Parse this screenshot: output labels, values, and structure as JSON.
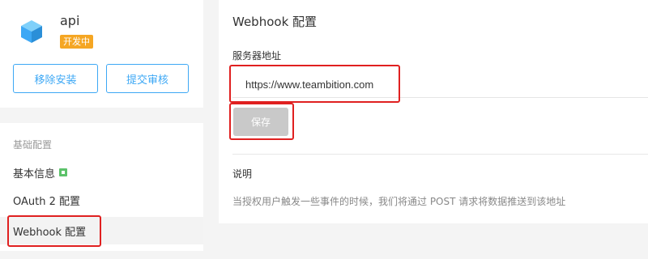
{
  "app": {
    "name": "api",
    "status_badge": "开发中",
    "uninstall_label": "移除安装",
    "submit_review_label": "提交审核",
    "icon": "cube-icon"
  },
  "sidebar": {
    "section_title": "基础配置",
    "items": [
      {
        "label": "基本信息",
        "badge_icon": "new-badge-icon"
      },
      {
        "label": "OAuth 2 配置"
      },
      {
        "label": "Webhook 配置",
        "active": true
      }
    ]
  },
  "main": {
    "title": "Webhook 配置",
    "server_label": "服务器地址",
    "server_value": "https://www.teambition.com",
    "save_label": "保存",
    "desc_title": "说明",
    "desc_text": "当授权用户触发一些事件的时候，我们将通过 POST 请求将数据推送到该地址"
  },
  "colors": {
    "accent": "#3da8f5",
    "badge": "#f5a623",
    "highlight": "#e02020",
    "save_disabled": "#c9c9c9"
  }
}
